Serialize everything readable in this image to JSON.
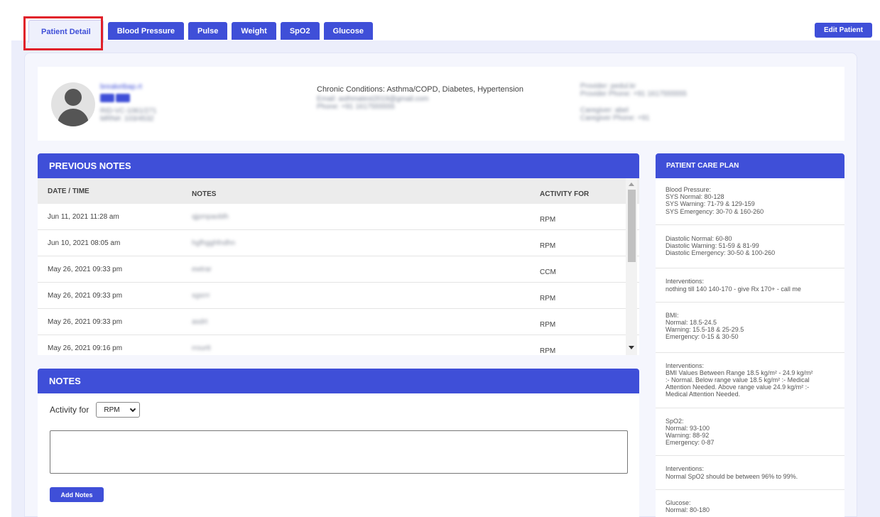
{
  "tabs": [
    {
      "label": "Patient Detail",
      "active": true
    },
    {
      "label": "Blood Pressure",
      "active": false
    },
    {
      "label": "Pulse",
      "active": false
    },
    {
      "label": "Weight",
      "active": false
    },
    {
      "label": "SpO2",
      "active": false
    },
    {
      "label": "Glucose",
      "active": false
    }
  ],
  "header": {
    "edit_label": "Edit Patient"
  },
  "patient": {
    "name": "breaketbap.rt",
    "line1": "RID-VC-1061/271",
    "line2": "MRN#: 103/4532",
    "chronic": "Chronic Conditions: Asthma/COPD, Diabetes, Hypertension",
    "email": "Email: asthmatest2019@gmail.com",
    "phone": "Phone: +91 1617555555",
    "provider": "Provider: pedul.kr",
    "provider_phone": "Provider Phone: +91 1617555555",
    "caregiver": "Caregiver: abel",
    "caregiver_phone": "Caregiver Phone: +91"
  },
  "previous_notes": {
    "title": "PREVIOUS NOTES",
    "columns": {
      "date": "DATE / TIME",
      "notes": "NOTES",
      "activity": "ACTIVITY FOR"
    },
    "rows": [
      {
        "date": "Jun 11, 2021 11:28 am",
        "note": "qjpmpaoblh",
        "activity": "RPM"
      },
      {
        "date": "Jun 10, 2021 08:05 am",
        "note": "hgfhgghfndhn",
        "activity": "RPM"
      },
      {
        "date": "May 26, 2021 09:33 pm",
        "note": "ewtrar",
        "activity": "CCM"
      },
      {
        "date": "May 26, 2021 09:33 pm",
        "note": "sgsrrr",
        "activity": "RPM"
      },
      {
        "date": "May 26, 2021 09:33 pm",
        "note": "asdrt",
        "activity": "RPM"
      },
      {
        "date": "May 26, 2021 09:16 pm",
        "note": "rrourtt",
        "activity": "RPM"
      }
    ]
  },
  "notes_form": {
    "title": "NOTES",
    "activity_label": "Activity for",
    "activity_value": "RPM",
    "text_value": "",
    "add_label": "Add Notes"
  },
  "care_plan": {
    "title": "PATIENT CARE PLAN",
    "items": [
      {
        "lines": [
          "Blood Pressure:",
          "SYS Normal: 80-128",
          "SYS Warning: 71-79 & 129-159",
          "SYS Emergency: 30-70 & 160-260"
        ]
      },
      {
        "lines": [
          "Diastolic Normal: 60-80",
          "Diastolic Warning: 51-59 & 81-99",
          "Diastolic Emergency: 30-50 & 100-260"
        ]
      },
      {
        "lines": [
          "Interventions:",
          "nothing till 140 140-170 - give Rx 170+ - call me"
        ]
      },
      {
        "lines": [
          "BMI:",
          "Normal: 18.5-24.5",
          "Warning: 15.5-18 & 25-29.5",
          "Emergency: 0-15 & 30-50"
        ]
      },
      {
        "lines": [
          "Interventions:",
          "BMI Values Between Range 18.5 kg/m² - 24.9 kg/m²",
          ":- Normal. Below range value 18.5 kg/m² :- Medical",
          "Attention Needed. Above range value 24.9 kg/m² :-",
          "Medical Attention Needed."
        ]
      },
      {
        "lines": [
          "SpO2:",
          "Normal: 93-100",
          "Warning: 88-92",
          "Emergency: 0-87"
        ]
      },
      {
        "lines": [
          "Interventions:",
          "Normal SpO2 should be between 96% to 99%."
        ]
      },
      {
        "lines": [
          "Glucose:",
          "Normal: 80-180"
        ]
      }
    ]
  }
}
